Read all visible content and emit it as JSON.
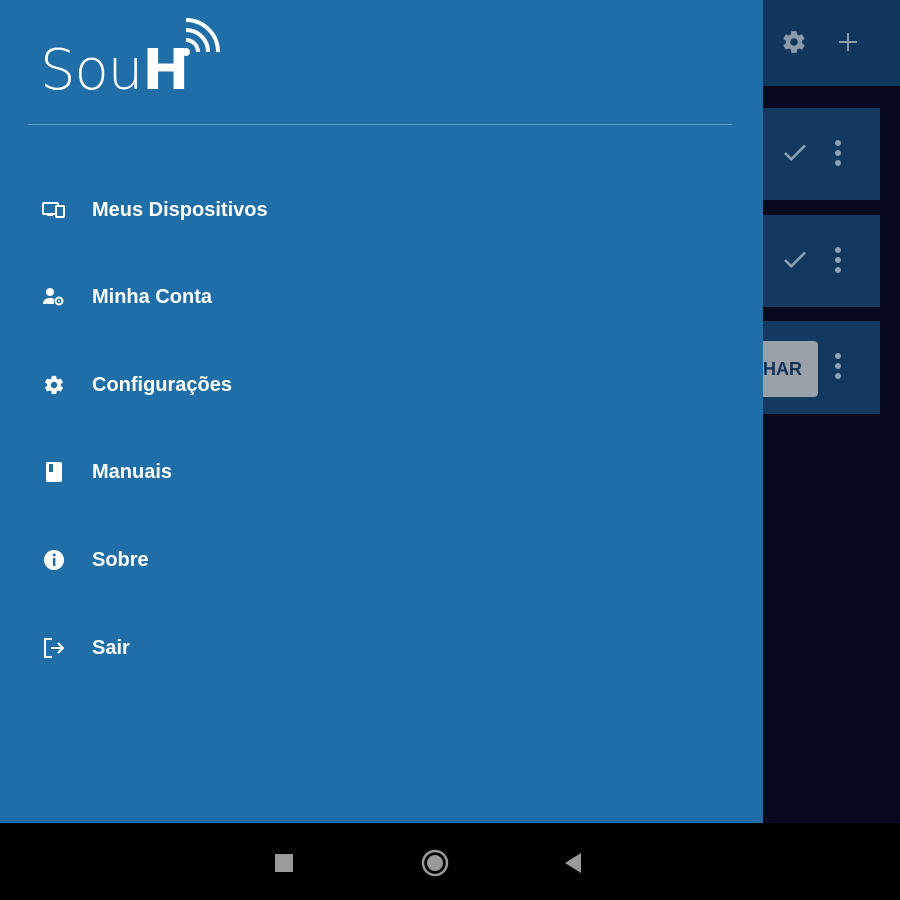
{
  "app": {
    "logo_text": "Sou",
    "logo_text_h": "H"
  },
  "background": {
    "toolbar": {
      "settings_icon": "gear-icon",
      "add_icon": "plus-icon"
    },
    "cards": [
      {
        "action_icon": "check-icon"
      },
      {
        "action_icon": "check-icon"
      },
      {
        "button_label": "HAR"
      }
    ]
  },
  "drawer": {
    "menu": [
      {
        "label": "Meus Dispositivos",
        "icon": "devices-icon"
      },
      {
        "label": "Minha Conta",
        "icon": "account-settings-icon"
      },
      {
        "label": "Configurações",
        "icon": "gear-icon"
      },
      {
        "label": "Manuais",
        "icon": "book-icon"
      },
      {
        "label": "Sobre",
        "icon": "info-icon"
      },
      {
        "label": "Sair",
        "icon": "logout-icon"
      }
    ]
  },
  "navbar": {
    "recents": "square-icon",
    "home": "circle-icon",
    "back": "triangle-back-icon"
  },
  "colors": {
    "drawer": "#1f6ea8",
    "toolbar": "#10385e",
    "card": "#123a61"
  }
}
